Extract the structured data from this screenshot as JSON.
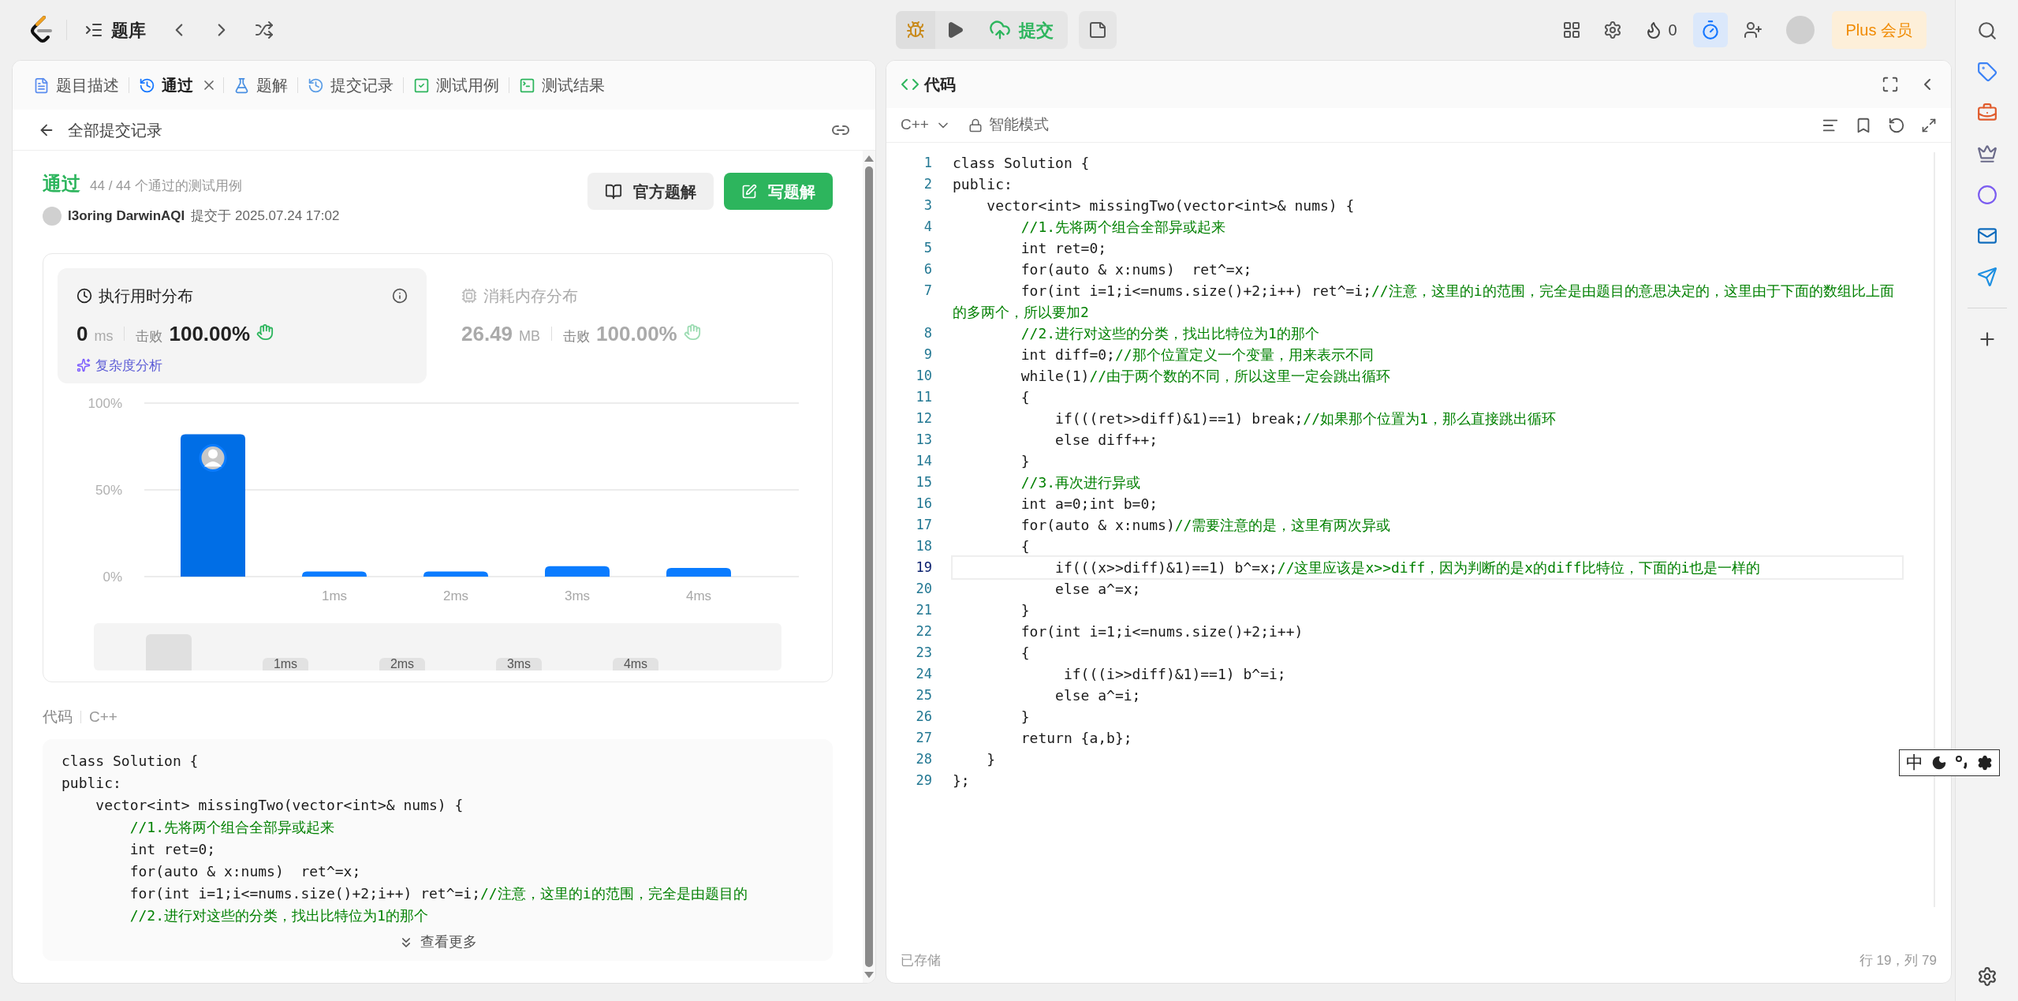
{
  "topbar": {
    "title": "题库",
    "submit": "提交",
    "streak": "0",
    "timer_on": true,
    "plus": "Plus 会员"
  },
  "left_tabs": [
    {
      "label": "题目描述",
      "selected": false,
      "closable": false
    },
    {
      "label": "通过",
      "selected": true,
      "closable": true
    },
    {
      "label": "题解",
      "selected": false,
      "closable": false
    },
    {
      "label": "提交记录",
      "selected": false,
      "closable": false
    },
    {
      "label": "测试用例",
      "selected": false,
      "closable": false
    },
    {
      "label": "测试结果",
      "selected": false,
      "closable": false
    }
  ],
  "back_link": "全部提交记录",
  "result": {
    "status": "通过",
    "cases": "44 / 44 个通过的测试用例",
    "user": "l3oring DarwinAQI",
    "submitted": "提交于 2025.07.24 17:02"
  },
  "buttons": [
    {
      "label": "官方题解",
      "kind": "secondary"
    },
    {
      "label": "写题解",
      "kind": "primary"
    }
  ],
  "stats": [
    {
      "title": "执行用时分布",
      "value": "0",
      "unit": "ms",
      "beat_label": "击败",
      "beat": "100.00%",
      "selected": true
    },
    {
      "title": "消耗内存分布",
      "value": "26.49",
      "unit": "MB",
      "beat_label": "击败",
      "beat": "100.00%",
      "selected": false
    }
  ],
  "complexity_link": "复杂度分析",
  "chart_data": {
    "type": "bar",
    "categories": [
      null,
      "1ms",
      "2ms",
      "3ms",
      "4ms"
    ],
    "values": [
      82,
      3,
      3,
      6,
      5
    ],
    "ylim": [
      0,
      100
    ],
    "yticks": [
      {
        "value": 0,
        "label": "0%"
      },
      {
        "value": 50,
        "label": "50%"
      },
      {
        "value": 100,
        "label": "100%"
      }
    ]
  },
  "overview_labels": [
    "1ms",
    "2ms",
    "3ms",
    "4ms"
  ],
  "code_preview": {
    "label": "代码",
    "language": "C++",
    "more": "查看更多",
    "lines": [
      {
        "code": "class Solution {"
      },
      {
        "code": "public:"
      },
      {
        "code": "    vector<int> missingTwo(vector<int>& nums) {"
      },
      {
        "comment": "        //1.先将两个组合全部异或起来"
      },
      {
        "code": "        int ret=0;"
      },
      {
        "code": "        for(auto & x:nums)  ret^=x;"
      },
      {
        "code": "        for(int i=1;i<=nums.size()+2;i++) ret^=i;",
        "comment": "//注意，这里的i的范围，完全是由题目的"
      },
      {
        "comment": "        //2.进行对这些的分类，找出比特位为1的那个"
      }
    ]
  },
  "editor": {
    "title": "代码",
    "language": "C++",
    "mode": "智能模式",
    "saved": "已存储",
    "cursor": "行 19，列 79",
    "lines": [
      {
        "n": "1",
        "code": "class Solution {",
        "current": false
      },
      {
        "n": "2",
        "code": "public:",
        "current": false
      },
      {
        "n": "3",
        "code": "    vector<int> missingTwo(vector<int>& nums) {",
        "current": false
      },
      {
        "n": "4",
        "comment": "        //1.先将两个组合全部异或起来",
        "current": false
      },
      {
        "n": "5",
        "code": "        int ret=0;",
        "current": false
      },
      {
        "n": "6",
        "code": "        for(auto & x:nums)  ret^=x;",
        "current": false
      },
      {
        "n": "7",
        "code": "        for(int i=1;i<=nums.size()+2;i++) ret^=i;",
        "comment": "//注意，这里的i的范围，完全是由题目的意思决定的，这里由于下面的数组比上面的多两个，所以要加2",
        "current": false
      },
      {
        "n": "8",
        "comment": "        //2.进行对这些的分类，找出比特位为1的那个",
        "current": false
      },
      {
        "n": "9",
        "code": "        int diff=0;",
        "comment": "//那个位置定义一个变量，用来表示不同",
        "current": false
      },
      {
        "n": "10",
        "code": "        while(1)",
        "comment": "//由于两个数的不同，所以这里一定会跳出循环",
        "current": false
      },
      {
        "n": "11",
        "code": "        {",
        "current": false
      },
      {
        "n": "12",
        "code": "            if(((ret>>diff)&1)==1) break;",
        "comment": "//如果那个位置为1，那么直接跳出循环",
        "current": false
      },
      {
        "n": "13",
        "code": "            else diff++;",
        "current": false
      },
      {
        "n": "14",
        "code": "        }",
        "current": false
      },
      {
        "n": "15",
        "comment": "        //3.再次进行异或",
        "current": false
      },
      {
        "n": "16",
        "code": "        int a=0;int b=0;",
        "current": false
      },
      {
        "n": "17",
        "code": "        for(auto & x:nums)",
        "comment": "//需要注意的是，这里有两次异或",
        "current": false
      },
      {
        "n": "18",
        "code": "        {",
        "current": false
      },
      {
        "n": "19",
        "code": "            if(((x>>diff)&1)==1) b^=x;",
        "comment": "//这里应该是x>>diff，因为判断的是x的diff比特位，下面的i也是一样的",
        "current": true
      },
      {
        "n": "20",
        "code": "            else a^=x;",
        "current": false
      },
      {
        "n": "21",
        "code": "        }",
        "current": false
      },
      {
        "n": "22",
        "code": "        for(int i=1;i<=nums.size()+2;i++)",
        "current": false
      },
      {
        "n": "23",
        "code": "        {",
        "current": false
      },
      {
        "n": "24",
        "code": "             if(((i>>diff)&1)==1) b^=i;",
        "current": false
      },
      {
        "n": "25",
        "code": "            else a^=i;",
        "current": false
      },
      {
        "n": "26",
        "code": "        }",
        "current": false
      },
      {
        "n": "27",
        "code": "        return {a,b};",
        "current": false
      },
      {
        "n": "28",
        "code": "    }",
        "current": false
      },
      {
        "n": "29",
        "code": "};",
        "current": false
      }
    ]
  },
  "ime_bar": {
    "label": "中"
  }
}
